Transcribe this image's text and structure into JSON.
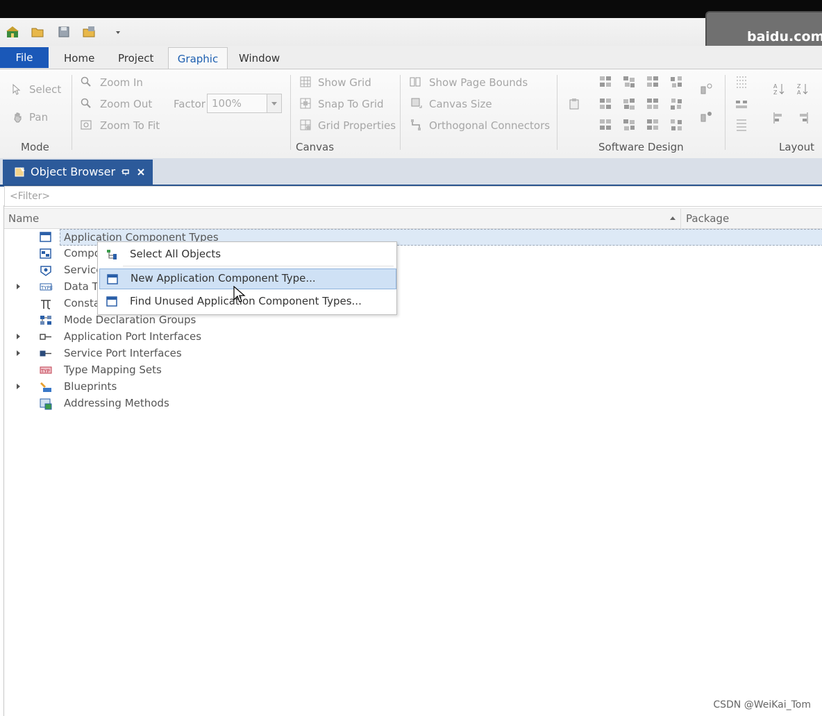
{
  "watermark_top": "baidu.com",
  "menu_tabs": {
    "file": "File",
    "home": "Home",
    "project": "Project",
    "graphic": "Graphic",
    "window": "Window"
  },
  "ribbon": {
    "mode": {
      "select": "Select",
      "pan": "Pan",
      "label": "Mode"
    },
    "canvas": {
      "zoom_in": "Zoom In",
      "zoom_out": "Zoom Out",
      "zoom_to_fit": "Zoom To Fit",
      "factor_label": "Factor",
      "factor_value": "100%",
      "show_grid": "Show Grid",
      "snap_to_grid": "Snap To Grid",
      "grid_properties": "Grid Properties",
      "show_page_bounds": "Show Page Bounds",
      "canvas_size": "Canvas Size",
      "orthogonal_connectors": "Orthogonal Connectors",
      "label": "Canvas"
    },
    "software_design": {
      "label": "Software Design"
    },
    "layout": {
      "label": "Layout"
    }
  },
  "object_browser": {
    "title": "Object Browser",
    "filter_placeholder": "<Filter>",
    "columns": {
      "name": "Name",
      "package": "Package"
    },
    "tree_items": [
      {
        "label": "Application Component Types",
        "expandable": false,
        "selected": true
      },
      {
        "label": "Compo",
        "expandable": false
      },
      {
        "label": "Service",
        "expandable": false
      },
      {
        "label": "Data T",
        "expandable": true
      },
      {
        "label": "Consta",
        "expandable": false
      },
      {
        "label": "Mode Declaration Groups",
        "expandable": false
      },
      {
        "label": "Application Port Interfaces",
        "expandable": true
      },
      {
        "label": "Service Port Interfaces",
        "expandable": true
      },
      {
        "label": "Type Mapping Sets",
        "expandable": false
      },
      {
        "label": "Blueprints",
        "expandable": true
      },
      {
        "label": "Addressing Methods",
        "expandable": false
      }
    ]
  },
  "context_menu": {
    "items": [
      {
        "label": "Select All Objects"
      },
      {
        "label": "New Application Component Type...",
        "highlighted": true
      },
      {
        "label": "Find Unused Application Component Types..."
      }
    ]
  },
  "footer_watermark": "CSDN @WeiKai_Tom"
}
